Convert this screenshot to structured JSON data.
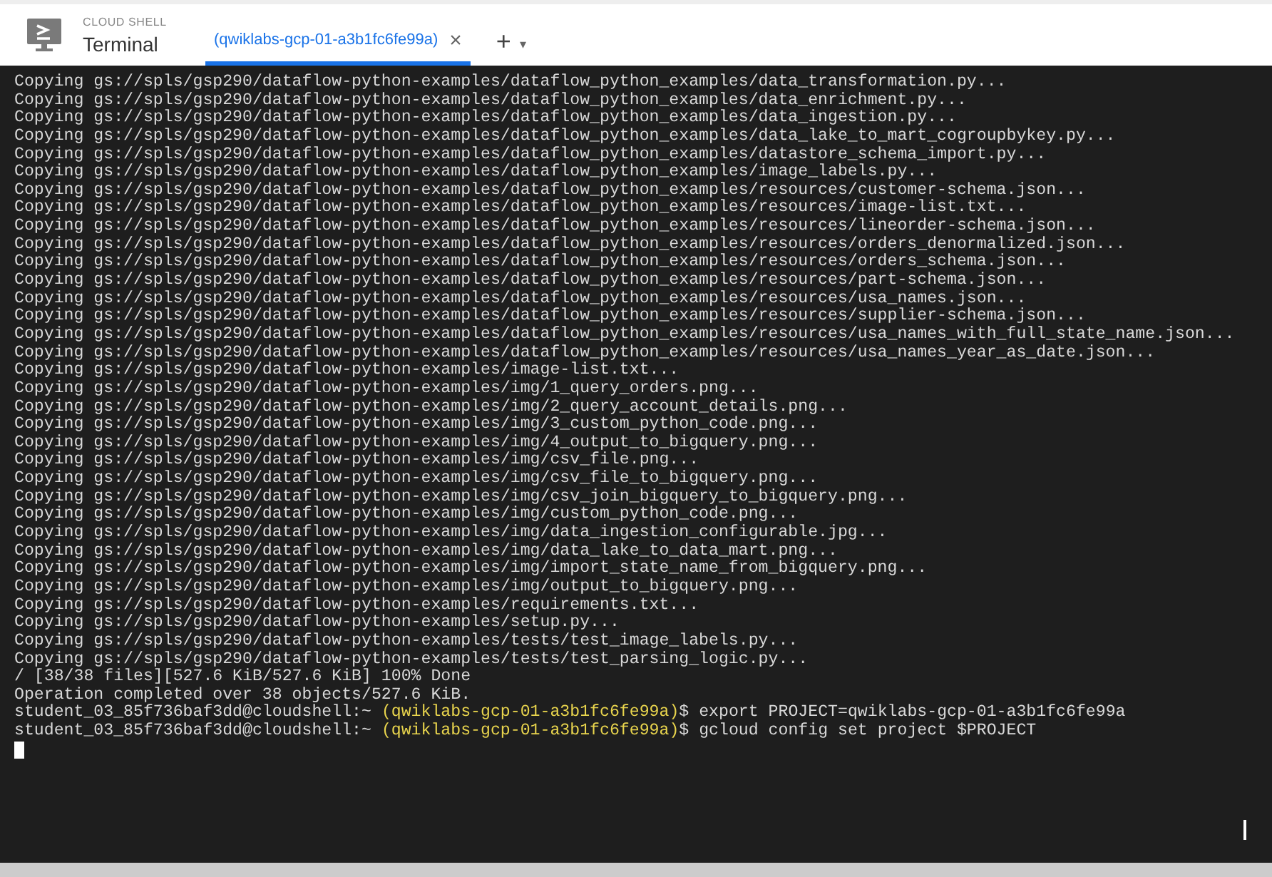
{
  "header": {
    "subtitle": "CLOUD SHELL",
    "title": "Terminal"
  },
  "tabs": [
    {
      "label": "(qwiklabs-gcp-01-a3b1fc6fe99a)",
      "selected": true,
      "close": "×"
    }
  ],
  "tab_actions": {
    "add": "+",
    "menu": "▾"
  },
  "terminal": {
    "lines": [
      {
        "kind": "output",
        "text": "Copying gs://spls/gsp290/dataflow-python-examples/dataflow_python_examples/data_transformation.py..."
      },
      {
        "kind": "output",
        "text": "Copying gs://spls/gsp290/dataflow-python-examples/dataflow_python_examples/data_enrichment.py..."
      },
      {
        "kind": "output",
        "text": "Copying gs://spls/gsp290/dataflow-python-examples/dataflow_python_examples/data_ingestion.py..."
      },
      {
        "kind": "output",
        "text": "Copying gs://spls/gsp290/dataflow-python-examples/dataflow_python_examples/data_lake_to_mart_cogroupbykey.py..."
      },
      {
        "kind": "output",
        "text": "Copying gs://spls/gsp290/dataflow-python-examples/dataflow_python_examples/datastore_schema_import.py..."
      },
      {
        "kind": "output",
        "text": "Copying gs://spls/gsp290/dataflow-python-examples/dataflow_python_examples/image_labels.py..."
      },
      {
        "kind": "output",
        "text": "Copying gs://spls/gsp290/dataflow-python-examples/dataflow_python_examples/resources/customer-schema.json..."
      },
      {
        "kind": "output",
        "text": "Copying gs://spls/gsp290/dataflow-python-examples/dataflow_python_examples/resources/image-list.txt..."
      },
      {
        "kind": "output",
        "text": "Copying gs://spls/gsp290/dataflow-python-examples/dataflow_python_examples/resources/lineorder-schema.json..."
      },
      {
        "kind": "output",
        "text": "Copying gs://spls/gsp290/dataflow-python-examples/dataflow_python_examples/resources/orders_denormalized.json..."
      },
      {
        "kind": "output",
        "text": "Copying gs://spls/gsp290/dataflow-python-examples/dataflow_python_examples/resources/orders_schema.json..."
      },
      {
        "kind": "output",
        "text": "Copying gs://spls/gsp290/dataflow-python-examples/dataflow_python_examples/resources/part-schema.json..."
      },
      {
        "kind": "output",
        "text": "Copying gs://spls/gsp290/dataflow-python-examples/dataflow_python_examples/resources/usa_names.json..."
      },
      {
        "kind": "output",
        "text": "Copying gs://spls/gsp290/dataflow-python-examples/dataflow_python_examples/resources/supplier-schema.json..."
      },
      {
        "kind": "output",
        "text": "Copying gs://spls/gsp290/dataflow-python-examples/dataflow_python_examples/resources/usa_names_with_full_state_name.json..."
      },
      {
        "kind": "output",
        "text": "Copying gs://spls/gsp290/dataflow-python-examples/dataflow_python_examples/resources/usa_names_year_as_date.json..."
      },
      {
        "kind": "output",
        "text": "Copying gs://spls/gsp290/dataflow-python-examples/image-list.txt..."
      },
      {
        "kind": "output",
        "text": "Copying gs://spls/gsp290/dataflow-python-examples/img/1_query_orders.png..."
      },
      {
        "kind": "output",
        "text": "Copying gs://spls/gsp290/dataflow-python-examples/img/2_query_account_details.png..."
      },
      {
        "kind": "output",
        "text": "Copying gs://spls/gsp290/dataflow-python-examples/img/3_custom_python_code.png..."
      },
      {
        "kind": "output",
        "text": "Copying gs://spls/gsp290/dataflow-python-examples/img/4_output_to_bigquery.png..."
      },
      {
        "kind": "output",
        "text": "Copying gs://spls/gsp290/dataflow-python-examples/img/csv_file.png..."
      },
      {
        "kind": "output",
        "text": "Copying gs://spls/gsp290/dataflow-python-examples/img/csv_file_to_bigquery.png..."
      },
      {
        "kind": "output",
        "text": "Copying gs://spls/gsp290/dataflow-python-examples/img/csv_join_bigquery_to_bigquery.png..."
      },
      {
        "kind": "output",
        "text": "Copying gs://spls/gsp290/dataflow-python-examples/img/custom_python_code.png..."
      },
      {
        "kind": "output",
        "text": "Copying gs://spls/gsp290/dataflow-python-examples/img/data_ingestion_configurable.jpg..."
      },
      {
        "kind": "output",
        "text": "Copying gs://spls/gsp290/dataflow-python-examples/img/data_lake_to_data_mart.png..."
      },
      {
        "kind": "output",
        "text": "Copying gs://spls/gsp290/dataflow-python-examples/img/import_state_name_from_bigquery.png..."
      },
      {
        "kind": "output",
        "text": "Copying gs://spls/gsp290/dataflow-python-examples/img/output_to_bigquery.png..."
      },
      {
        "kind": "output",
        "text": "Copying gs://spls/gsp290/dataflow-python-examples/requirements.txt..."
      },
      {
        "kind": "output",
        "text": "Copying gs://spls/gsp290/dataflow-python-examples/setup.py..."
      },
      {
        "kind": "output",
        "text": "Copying gs://spls/gsp290/dataflow-python-examples/tests/test_image_labels.py..."
      },
      {
        "kind": "output",
        "text": "Copying gs://spls/gsp290/dataflow-python-examples/tests/test_parsing_logic.py..."
      },
      {
        "kind": "output",
        "text": "/ [38/38 files][527.6 KiB/527.6 KiB] 100% Done"
      },
      {
        "kind": "output",
        "text": "Operation completed over 38 objects/527.6 KiB."
      },
      {
        "kind": "prompt",
        "user": "student_03_85f736baf3dd@cloudshell:~",
        "project": "(qwiklabs-gcp-01-a3b1fc6fe99a)",
        "command": "$ export PROJECT=qwiklabs-gcp-01-a3b1fc6fe99a"
      },
      {
        "kind": "prompt",
        "user": "student_03_85f736baf3dd@cloudshell:~",
        "project": "(qwiklabs-gcp-01-a3b1fc6fe99a)",
        "command": "$ gcloud config set project $PROJECT"
      },
      {
        "kind": "cursor"
      }
    ]
  }
}
